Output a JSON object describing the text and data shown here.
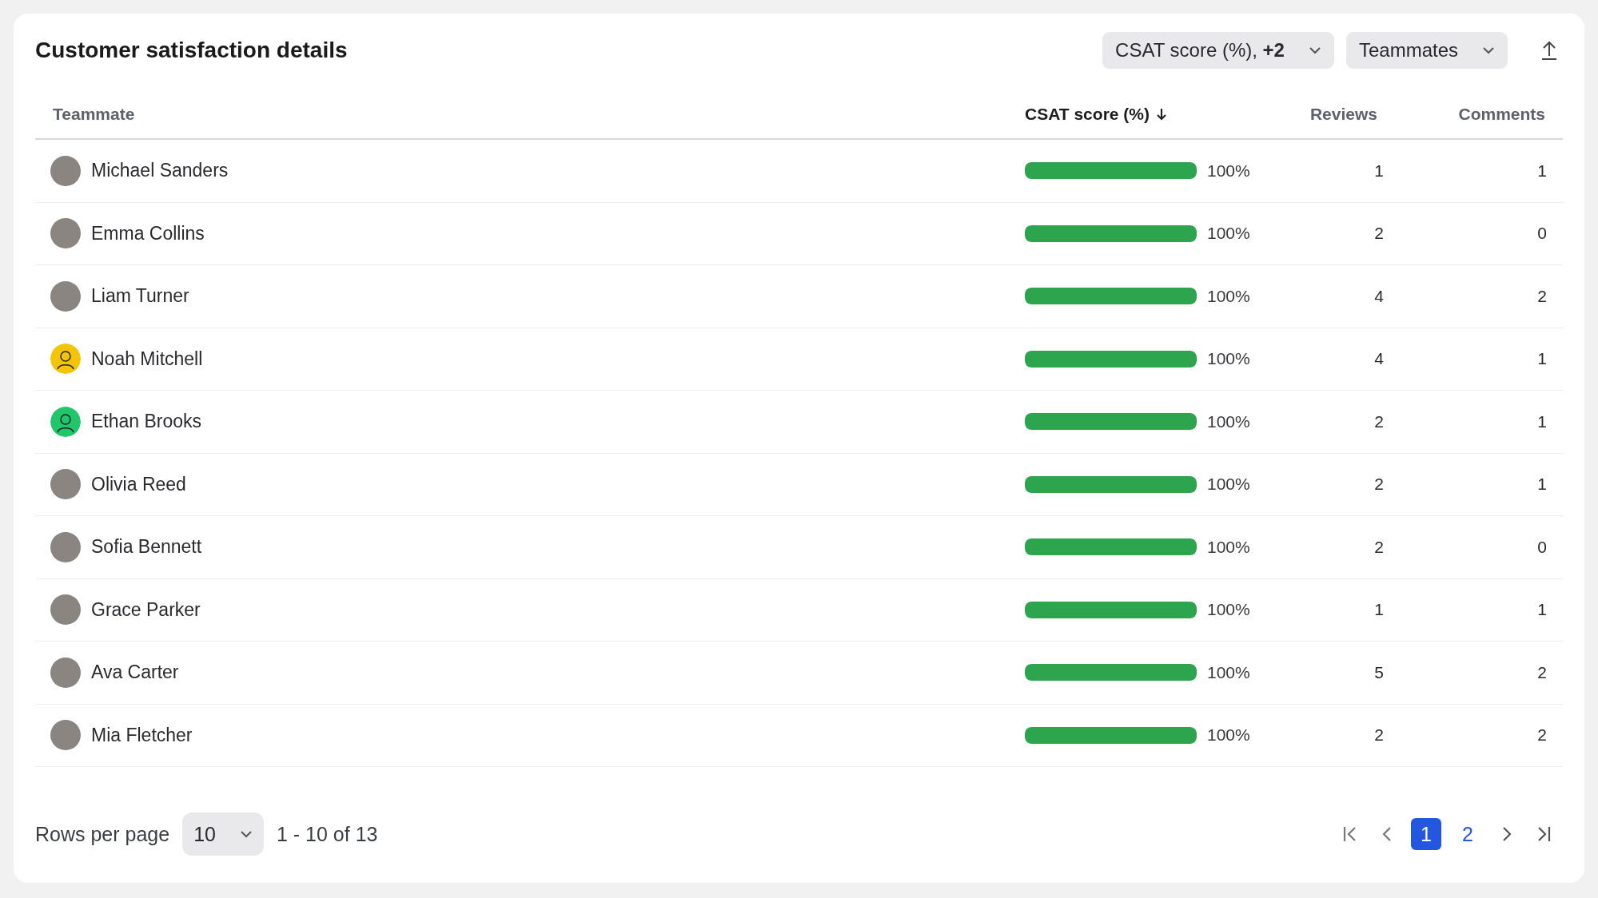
{
  "title": "Customer satisfaction details",
  "filters": [
    {
      "label": "CSAT score (%), **+2**"
    },
    {
      "label": "Teammates"
    }
  ],
  "table": {
    "columns": [
      {
        "label": "Teammate",
        "sorted": false
      },
      {
        "label": "CSAT score (%)",
        "sorted": true
      },
      {
        "label": "Reviews",
        "sorted": false
      },
      {
        "label": "Comments",
        "sorted": false
      }
    ],
    "rows": [
      {
        "name": "Michael Sanders",
        "photo": true,
        "level": 1,
        "score": "100%",
        "reviews": "1",
        "comments": "1"
      },
      {
        "name": "Emma Collins",
        "photo": true,
        "level": 1,
        "score": "100%",
        "reviews": "2",
        "comments": "0"
      },
      {
        "name": "Liam Turner",
        "photo": true,
        "level": 1,
        "score": "100%",
        "reviews": "4",
        "comments": "2"
      },
      {
        "name": "Noah Mitchell",
        "photo": false,
        "color": "#f5c400",
        "level": 1,
        "score": "100%",
        "reviews": "4",
        "comments": "1"
      },
      {
        "name": "Ethan Brooks",
        "photo": false,
        "color": "#1fc76a",
        "level": 1,
        "score": "100%",
        "reviews": "2",
        "comments": "1"
      },
      {
        "name": "Olivia Reed",
        "photo": true,
        "level": 1,
        "score": "100%",
        "reviews": "2",
        "comments": "1"
      },
      {
        "name": "Sofia Bennett",
        "photo": true,
        "level": 1,
        "score": "100%",
        "reviews": "2",
        "comments": "0"
      },
      {
        "name": "Grace Parker",
        "photo": true,
        "level": 1,
        "score": "100%",
        "reviews": "1",
        "comments": "1"
      },
      {
        "name": "Ava Carter",
        "photo": true,
        "level": 1,
        "score": "100%",
        "reviews": "5",
        "comments": "2"
      },
      {
        "name": "Mia Fletcher",
        "photo": true,
        "level": 1,
        "score": "100%",
        "reviews": "2",
        "comments": "2"
      }
    ]
  },
  "footer": {
    "rows_label": "Rows per page",
    "rows_value": "10",
    "range": "1 - 10 of 13",
    "pages": [
      {
        "label": "1",
        "selected": true
      },
      {
        "label": "2",
        "selected": false
      }
    ]
  }
}
